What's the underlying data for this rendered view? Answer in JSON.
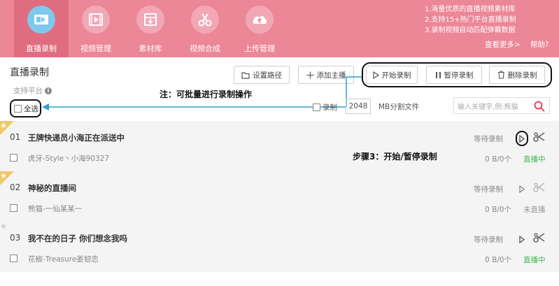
{
  "nav": {
    "items": [
      {
        "label": "直播录制",
        "icon": "video-icon"
      },
      {
        "label": "视频管理",
        "icon": "film-icon"
      },
      {
        "label": "素材库",
        "icon": "download-box-icon"
      },
      {
        "label": "视频合成",
        "icon": "scissors-icon"
      },
      {
        "label": "上传管理",
        "icon": "cloud-upload-icon"
      }
    ],
    "active_index": 0
  },
  "tips": [
    "1.海量优质的直播视频素材库",
    "2.支持15+热门平台直播录制",
    "3.录制视频自动匹配弹幕数据"
  ],
  "see_more": "查看更多>",
  "help": "帮助?",
  "page_title": "直播录制",
  "platform_label": "支持平台",
  "select_all": "全选",
  "toolbar": {
    "set_path": "设置路径",
    "add_streamer": "添加主播",
    "start_record": "开始录制",
    "pause_record": "暂停录制",
    "delete_record": "删除录制"
  },
  "annotations": {
    "batch_note": "注：可批量进行录制操作",
    "step3_note": "步骤3：开始/暂停录制"
  },
  "record_split": {
    "checkbox_label": "录制",
    "value": "2048",
    "unit_label": "MB分割文件"
  },
  "search": {
    "placeholder": "输入关键字,例:熊猫"
  },
  "rows": [
    {
      "num": "01",
      "title": "王牌快递员小海正在派送中",
      "streamer": "虎牙-Style丶小海90327",
      "status": "等待录制",
      "size": "0 B/0个",
      "live": "直播中"
    },
    {
      "num": "02",
      "title": "神秘的直播间",
      "streamer": "熊猫-一仙某某一",
      "status": "等待录制",
      "size": "0 B/0个",
      "live": "未直播"
    },
    {
      "num": "03",
      "title": "我不在的日子 你们想念我吗",
      "streamer": "花椒-Treasure姜韧恋",
      "status": "等待录制",
      "size": "0 B/0个",
      "live": "直播中"
    }
  ],
  "colors": {
    "topbar": "#ec8797",
    "active_tab": "#e06c7f",
    "active_icon_circle": "#7ec8ee",
    "annotation_arrow": "#2a9fd0",
    "live": "#3fb950",
    "offline": "#999999",
    "search_icon": "#e04a5f"
  }
}
